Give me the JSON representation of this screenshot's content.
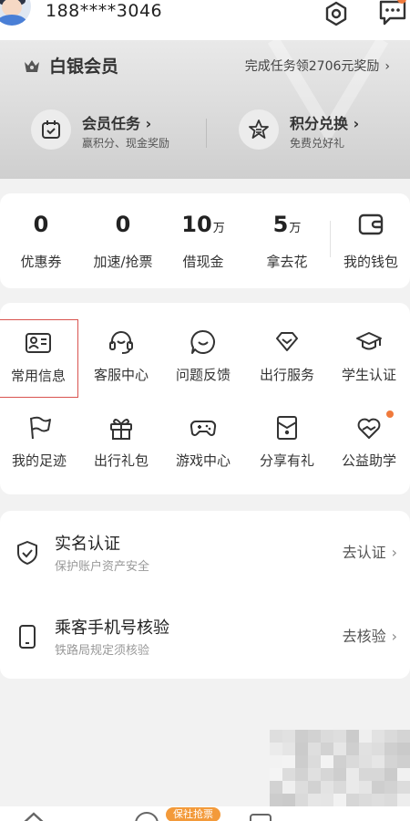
{
  "header": {
    "phone": "188****3046",
    "settings_icon": "settings-hex-icon",
    "message_icon": "message-icon",
    "message_badge_color": "#f07a3c"
  },
  "member": {
    "tier": "白银会员",
    "task_link": "完成任务领2706元奖励",
    "cards": [
      {
        "title": "会员任务 ›",
        "subtitle": "赢积分、现金奖励",
        "icon": "calendar-check-icon"
      },
      {
        "title": "积分兑换 ›",
        "subtitle": "免费兑好礼",
        "icon": "star-exchange-icon"
      }
    ]
  },
  "stats": [
    {
      "value": "0",
      "unit": "",
      "label": "优惠券"
    },
    {
      "value": "0",
      "unit": "",
      "label": "加速/抢票"
    },
    {
      "value": "10",
      "unit": "万",
      "label": "借现金"
    },
    {
      "value": "5",
      "unit": "万",
      "label": "拿去花"
    },
    {
      "value": "",
      "unit": "",
      "label": "我的钱包",
      "icon": "wallet-icon"
    }
  ],
  "services": [
    {
      "label": "常用信息",
      "icon": "id-card-icon",
      "highlighted": true
    },
    {
      "label": "客服中心",
      "icon": "headset-icon"
    },
    {
      "label": "问题反馈",
      "icon": "feedback-bubble-icon"
    },
    {
      "label": "出行服务",
      "icon": "diamond-heart-icon"
    },
    {
      "label": "学生认证",
      "icon": "graduation-cap-icon"
    },
    {
      "label": "我的足迹",
      "icon": "flag-icon"
    },
    {
      "label": "出行礼包",
      "icon": "gift-icon"
    },
    {
      "label": "游戏中心",
      "icon": "gamepad-icon"
    },
    {
      "label": "分享有礼",
      "icon": "share-envelope-icon"
    },
    {
      "label": "公益助学",
      "icon": "charity-heart-icon",
      "badge": true
    }
  ],
  "list": [
    {
      "title": "实名认证",
      "subtitle": "保护账户资产安全",
      "action": "去认证",
      "icon": "shield-check-icon"
    },
    {
      "title": "乘客手机号核验",
      "subtitle": "铁路局规定须核验",
      "action": "去核验",
      "icon": "mobile-phone-icon"
    }
  ],
  "bottom_nav": {
    "badge": "保社抢票"
  },
  "colors": {
    "accent": "#f07a3c",
    "highlight_border": "#d9534f",
    "member_bg": "#d8d8d8"
  }
}
